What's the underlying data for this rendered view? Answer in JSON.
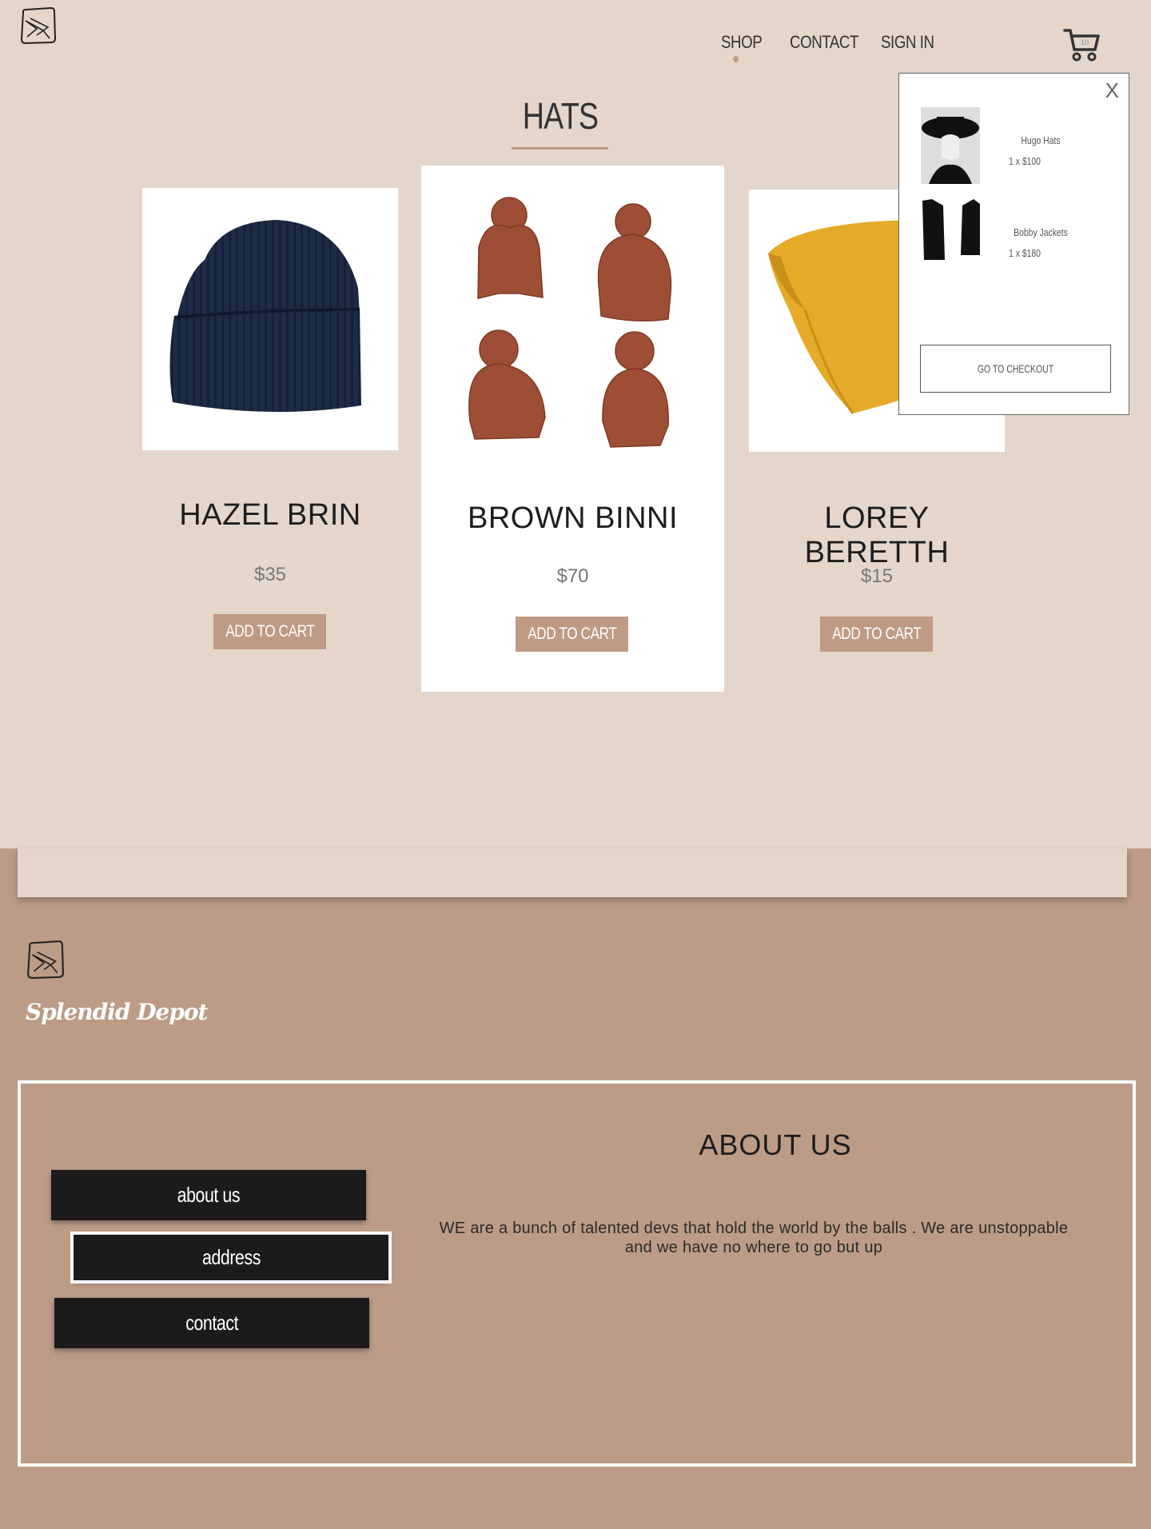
{
  "header": {
    "nav": {
      "shop": "SHOP",
      "contact": "CONTACT",
      "sign_in": "SIGN IN"
    },
    "cart_count": "10"
  },
  "page": {
    "title": "HATS"
  },
  "products": [
    {
      "name": "HAZEL BRIN",
      "price": "$35",
      "button": "ADD TO CART"
    },
    {
      "name": "BROWN BINNI",
      "price": "$70",
      "button": "ADD TO CART"
    },
    {
      "name": "LOREY BERETTH",
      "price": "$15",
      "button": "ADD TO CART"
    }
  ],
  "cart_popup": {
    "close": "X",
    "items": [
      {
        "name": "Hugo Hats",
        "qty": "1 x $100"
      },
      {
        "name": "Bobby Jackets",
        "qty": "1 x $180"
      }
    ],
    "checkout": "GO TO CHECKOUT"
  },
  "footer": {
    "brand": "Splendid Depot",
    "buttons": {
      "about": "about us",
      "address": "address",
      "contact": "contact"
    },
    "about_title": "ABOUT US",
    "about_text": "WE are a bunch of talented devs that hold the world by the balls . We are unstoppable and we have no where to go but up"
  },
  "colors": {
    "background": "#e4d6cb",
    "accent": "#bf9a85",
    "footer": "#bc9c87",
    "dark_button": "#1b1b1b"
  }
}
